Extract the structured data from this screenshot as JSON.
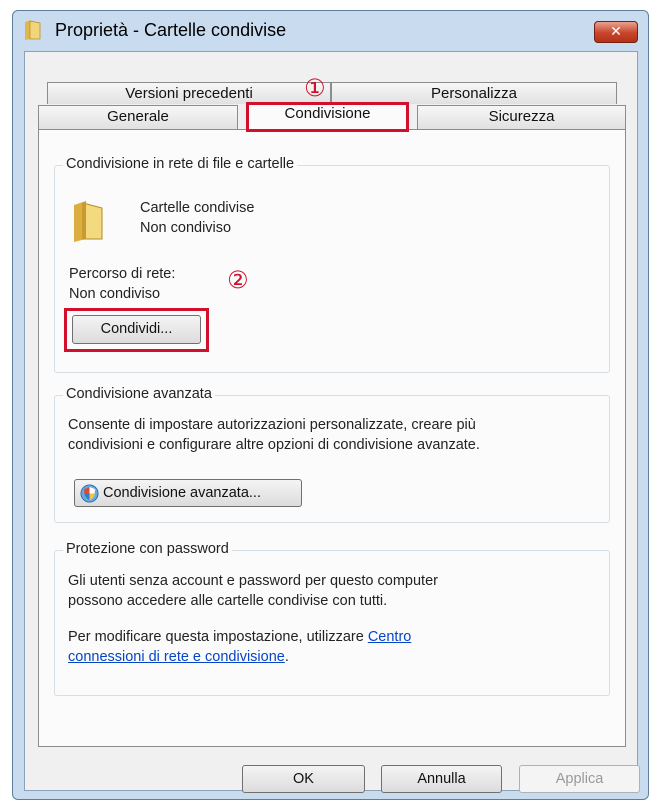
{
  "window": {
    "title": "Proprietà - Cartelle condivise",
    "close_glyph": "✕"
  },
  "tabs": {
    "row_top": [
      "Versioni precedenti",
      "Personalizza"
    ],
    "row_bottom": [
      "Generale",
      "Condivisione",
      "Sicurezza"
    ],
    "active": "Condivisione"
  },
  "markers": {
    "step1": "①",
    "step2": "②"
  },
  "sharing": {
    "group_title": "Condivisione in rete di file e cartelle",
    "folder_name": "Cartelle condivise",
    "folder_status": "Non condiviso",
    "network_path_label": "Percorso di rete:",
    "network_path_value": "Non condiviso",
    "share_button": "Condividi..."
  },
  "advanced": {
    "group_title": "Condivisione avanzata",
    "desc_line1": "Consente di impostare autorizzazioni personalizzate, creare più",
    "desc_line2": "condivisioni e configurare altre opzioni di condivisione avanzate.",
    "button": "Condivisione avanzata..."
  },
  "password": {
    "group_title": "Protezione con password",
    "line1": "Gli utenti senza account e password per questo computer",
    "line2": "possono accedere alle cartelle condivise con tutti.",
    "line3_prefix": "Per modificare questa impostazione, utilizzare ",
    "link_part1": "Centro",
    "link_part2": "connessioni di rete e condivisione",
    "line4_suffix": "."
  },
  "footer": {
    "ok": "OK",
    "cancel": "Annulla",
    "apply": "Applica"
  },
  "colors": {
    "highlight": "#d2102c",
    "link": "#0645c8",
    "window_frame": "#c9dcef"
  },
  "icons": [
    "folder-icon",
    "close-icon",
    "shield-icon"
  ]
}
